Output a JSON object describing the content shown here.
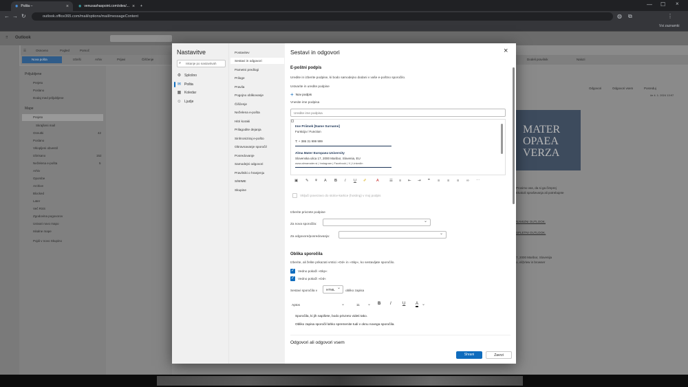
{
  "browser": {
    "tabs": [
      {
        "label": "Pošta – "
      },
      {
        "label": "venusashaspoint.com/sites/..."
      }
    ],
    "url": "outlook.office365.com/mail/options/mail/messageContent",
    "bookmarks_label": "Vsi zaznamki"
  },
  "outlook": {
    "app_name": "Outlook",
    "ribbon_tabs": [
      "Osnovno",
      "Pogled",
      "Pomoč"
    ],
    "ribbon_buttons": [
      "Nova pošta",
      "Izbriši",
      "Arhiv",
      "Prijavi",
      "Čiščenje"
    ],
    "ribbon_right": [
      "Dodeli pravilnik",
      "Nalozi"
    ],
    "rail": [
      "Pošta",
      "Koledar",
      "Ljudje",
      "Skupine",
      "Teams",
      "Word",
      "Excel",
      "PowerPoint",
      "Več aplikacij"
    ],
    "folders": {
      "favorites_header": "Priljubljene",
      "favorites": [
        "Prejeto",
        "Poslano",
        "Dodaj med priljubljene"
      ],
      "folders_header": "Mape",
      "items": [
        "Prejeto",
        "Skrajšeni mail",
        "Osnutki",
        "Poslano",
        "Vklopljeni obvestil",
        "Izbrisano",
        "Neželena e-pošta",
        "Arhiv",
        "Opombe",
        "Archive",
        "Blocked",
        "Later",
        "Več RSS",
        "Zgodovina pogovorov",
        "Ustvari novo mapo",
        "Iskalne mape",
        "Pojdi v novo Skupino"
      ],
      "counts": {
        "Osnutki": "42",
        "Izbrisano": "152",
        "Neželena e-pošta": "5",
        "Arhiv": "2"
      }
    },
    "reading": {
      "actions": [
        "Odgovori",
        "Odgovori vsem",
        "Posreduj"
      ],
      "date": "če 4. 1. 2024 13:97",
      "banner_text": "MATER\nOPAEA\nVERZA",
      "lines": [
        "Prosimo vas, da si ga čimprej",
        "Ekakoli spraševanja ali potrebujete",
        "NAMIZNI OUTLOOK.",
        "SPLETNI OUTLOOK.",
        "7, 2000 Maribor, Slovenija",
        "o, eli|View in browser"
      ]
    }
  },
  "settings": {
    "title": "Nastavitve",
    "search_placeholder": "Iskanje po nastavitvah",
    "categories": [
      {
        "label": "Splošno",
        "icon": "gear-icon",
        "glyph": "⚙"
      },
      {
        "label": "Pošta",
        "icon": "mail-icon",
        "glyph": "✉"
      },
      {
        "label": "Koledar",
        "icon": "calendar-icon",
        "glyph": "▦"
      },
      {
        "label": "Ljudje",
        "icon": "people-icon",
        "glyph": "☺"
      }
    ],
    "selected_category": "Pošta",
    "subcategories": [
      "Postavitev",
      "Sestavi in odgovori",
      "Pametni predlogi",
      "Priloge",
      "Pravila",
      "Pogojno oblikovanje",
      "Čiščenje",
      "Neželena e-pošta",
      "Hitri koraki",
      "Prilagodite dejanja",
      "Sinhroniziraj e-pošto",
      "Obravnavanje sporočil",
      "Posredovanje",
      "Samodejni odgovori",
      "Pravilniki o hranjenju",
      "S/MIME",
      "Skupine"
    ],
    "selected_subcategory": "Sestavi in odgovori",
    "close_icon": "close-icon"
  },
  "compose": {
    "heading": "Sestavi in odgovori",
    "signature": {
      "heading": "E-poštni podpis",
      "description": "Uredite in izberite podpise, ki bodo samodejno dodani v vaše e-poštno sporočilo.",
      "create_label": "Ustvarite in uredite podpise",
      "new_signature": "Nov podpis",
      "name_label": "Vnesite ime podpisa",
      "name_placeholder": "Uredite ime podpisa",
      "editor": {
        "name": "Ime Priimek [Name Surname]",
        "function": "Funkcija / Function",
        "phone": "T: + 386 31 999 999",
        "org": "Alma Mater Europaea University",
        "address": "Slovenska ulica 17, 2000 Maribor, Slovenia, EU",
        "links": "www.almamater.si | Instagram | Facebook | X | LinkedIn"
      },
      "toolbar_icons": [
        "image-icon",
        "paint-icon",
        "format-painter-icon",
        "font-size-icon",
        "bold-icon",
        "italic-icon",
        "underline-icon",
        "highlight-icon",
        "font-color-icon",
        "bullets-icon",
        "numbering-icon",
        "outdent-icon",
        "indent-icon",
        "quote-icon",
        "align-left-icon",
        "align-center-icon",
        "align-right-icon",
        "link-icon",
        "more-icon"
      ],
      "toolbar_glyphs": [
        "▣",
        "✎",
        "⚘",
        "A",
        "B",
        "I",
        "U",
        "✐",
        "A",
        "☰",
        "≡",
        "⇤",
        "⇥",
        "❞",
        "≡",
        "≡",
        "≡",
        "∞",
        "⋯"
      ],
      "include_checkbox": "Vključi povezavo do stolov-kartice (hosting) v moj podpis"
    },
    "default_signatures": {
      "heading": "Izberite privzete podpise",
      "new_label": "Za nova sporočila:",
      "reply_label": "Za odgovore/posredovanja:",
      "new_value": "",
      "reply_value": ""
    },
    "message_format": {
      "heading": "Oblika sporočila",
      "description": "Izberite, ali želite prikazati vrstici »Od« in »Skp«, ko sestavljate sporočilo.",
      "always_bcc": "Vedno pokaži »Skp«",
      "always_from": "Vedno pokaži »Od«",
      "compose_in_label": "Sestavi sporočila v",
      "format_value": "HTML",
      "format_suffix": "obliko zapisa",
      "font": "Aptos",
      "font_size": "11",
      "preview_line1": "Sporočila, ki jih napišete, bodo privzeto videti tako.",
      "preview_line2": "Obliko zapisa sporočil lahko spremenite tudi v oknu novega sporočila."
    },
    "reply_heading": "Odgovori ali odgovori vsem",
    "save_label": "Shrani",
    "cancel_label": "Zavrzi"
  }
}
